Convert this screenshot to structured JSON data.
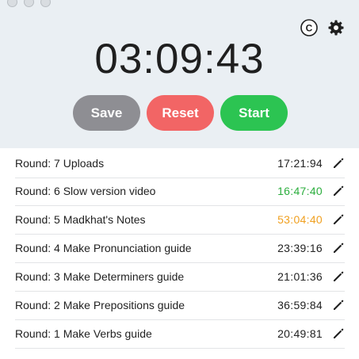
{
  "timer": {
    "display": "03:09:43"
  },
  "header_icons": [
    "c-circle-icon",
    "gear-icon"
  ],
  "header": {
    "c_label": "C"
  },
  "buttons": {
    "save": "Save",
    "reset": "Reset",
    "start": "Start"
  },
  "rounds": [
    {
      "label": "Round: 7  Uploads",
      "time": "17:21:94",
      "color": "#222222"
    },
    {
      "label": "Round: 6  Slow version video",
      "time": "16:47:40",
      "color": "#2cae3e"
    },
    {
      "label": "Round: 5  Madkhat's Notes",
      "time": "53:04:40",
      "color": "#f0a020"
    },
    {
      "label": "Round: 4  Make Pronunciation guide",
      "time": "23:39:16",
      "color": "#222222"
    },
    {
      "label": "Round: 3  Make Determiners guide",
      "time": "21:01:36",
      "color": "#222222"
    },
    {
      "label": "Round: 2  Make Prepositions guide",
      "time": "36:59:84",
      "color": "#222222"
    },
    {
      "label": "Round: 1  Make Verbs guide",
      "time": "20:49:81",
      "color": "#222222"
    }
  ]
}
